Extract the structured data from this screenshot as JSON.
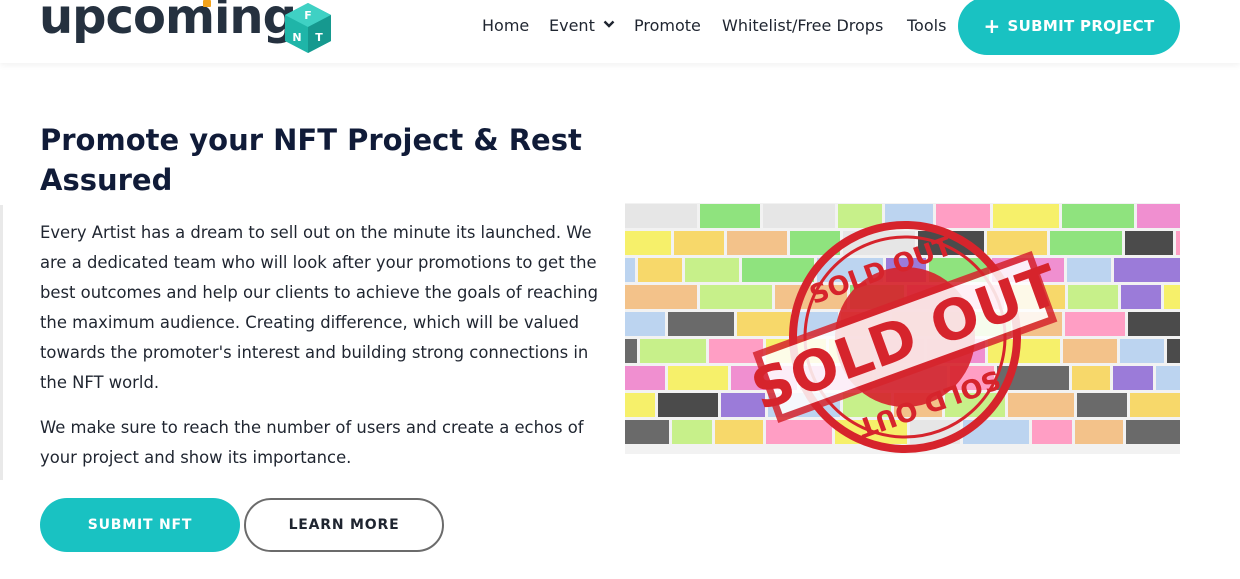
{
  "header": {
    "logo": {
      "wordmark": "upcoming",
      "cube_letters": [
        "F",
        "N",
        "T"
      ]
    },
    "nav": [
      {
        "label": "Home"
      },
      {
        "label": "Event",
        "has_dropdown": true
      },
      {
        "label": "Promote"
      },
      {
        "label": "Whitelist/Free Drops"
      },
      {
        "label": "Tools"
      }
    ],
    "submit_project_label": "SUBMIT PROJECT"
  },
  "main": {
    "title": "Promote your NFT Project & Rest Assured",
    "paragraphs": [
      "Every Artist has a dream to sell out on the minute its launched. We are a dedicated team who will look after your promotions to get the best outcomes and help our clients to achieve the goals of reaching the maximum audience. Creating difference, which will be valued towards the promoter's interest and building strong connections in the NFT world.",
      "We make sure to reach the number of users and create a echos of your project and show its importance."
    ],
    "buttons": {
      "submit_nft": "SUBMIT NFT",
      "learn_more": "LEARN MORE"
    }
  },
  "image": {
    "stamp_top": "SOLD OUT",
    "stamp_center": "SOLD OUT",
    "stamp_bottom": "SOLD OUT"
  },
  "colors": {
    "accent": "#19c2c2",
    "brand_dark": "#25313f",
    "logo_cube": "#1fb5a8",
    "stamp_red": "#d6242c"
  }
}
